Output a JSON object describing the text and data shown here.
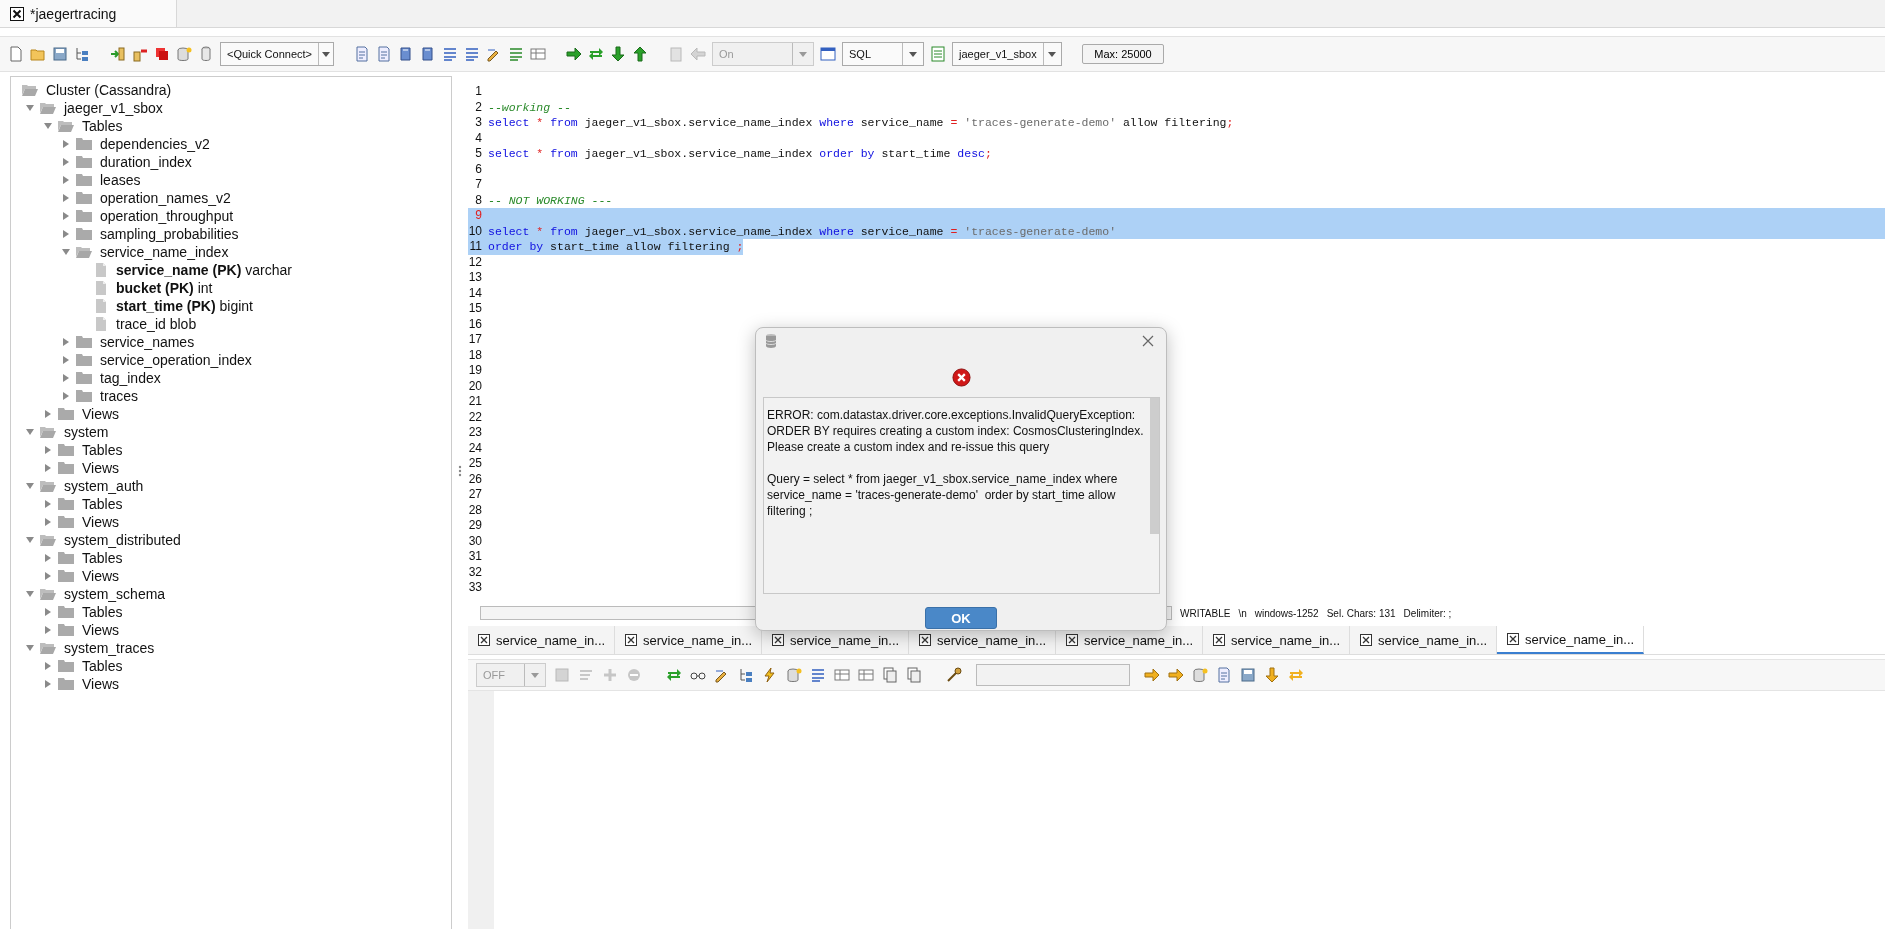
{
  "window_tab": {
    "title": "*jaegertracing",
    "selected": true
  },
  "toolbar": {
    "connection": "<Quick Connect>",
    "mode": {
      "value": "On",
      "disabled": true
    },
    "language": "SQL",
    "keyspace": "jaeger_v1_sbox",
    "max_rows": "Max: 25000"
  },
  "tree": [
    {
      "label": "Cluster (Cassandra)",
      "kind": "root",
      "expanded": true,
      "children": [
        {
          "label": "jaeger_v1_sbox",
          "kind": "folder",
          "expanded": true,
          "children": [
            {
              "label": "Tables",
              "kind": "folder",
              "expanded": true,
              "children": [
                {
                  "label": "dependencies_v2",
                  "kind": "folder",
                  "expanded": false
                },
                {
                  "label": "duration_index",
                  "kind": "folder",
                  "expanded": false
                },
                {
                  "label": "leases",
                  "kind": "folder",
                  "expanded": false
                },
                {
                  "label": "operation_names_v2",
                  "kind": "folder",
                  "expanded": false
                },
                {
                  "label": "operation_throughput",
                  "kind": "folder",
                  "expanded": false
                },
                {
                  "label": "sampling_probabilities",
                  "kind": "folder",
                  "expanded": false
                },
                {
                  "label": "service_name_index",
                  "kind": "folder",
                  "expanded": true,
                  "children": [
                    {
                      "label": "**service_name (PK)** varchar",
                      "kind": "column"
                    },
                    {
                      "label": "**bucket (PK)** int",
                      "kind": "column"
                    },
                    {
                      "label": "**start_time (PK)** bigint",
                      "kind": "column"
                    },
                    {
                      "label": "trace_id blob",
                      "kind": "column"
                    }
                  ]
                },
                {
                  "label": "service_names",
                  "kind": "folder",
                  "expanded": false
                },
                {
                  "label": "service_operation_index",
                  "kind": "folder",
                  "expanded": false
                },
                {
                  "label": "tag_index",
                  "kind": "folder",
                  "expanded": false
                },
                {
                  "label": "traces",
                  "kind": "folder",
                  "expanded": false
                }
              ]
            },
            {
              "label": "Views",
              "kind": "folder",
              "expanded": false
            }
          ]
        },
        {
          "label": "system",
          "kind": "folder",
          "expanded": true,
          "children": [
            {
              "label": "Tables",
              "kind": "folder",
              "expanded": false
            },
            {
              "label": "Views",
              "kind": "folder",
              "expanded": false
            }
          ]
        },
        {
          "label": "system_auth",
          "kind": "folder",
          "expanded": true,
          "children": [
            {
              "label": "Tables",
              "kind": "folder",
              "expanded": false
            },
            {
              "label": "Views",
              "kind": "folder",
              "expanded": false
            }
          ]
        },
        {
          "label": "system_distributed",
          "kind": "folder",
          "expanded": true,
          "children": [
            {
              "label": "Tables",
              "kind": "folder",
              "expanded": false
            },
            {
              "label": "Views",
              "kind": "folder",
              "expanded": false
            }
          ]
        },
        {
          "label": "system_schema",
          "kind": "folder",
          "expanded": true,
          "children": [
            {
              "label": "Tables",
              "kind": "folder",
              "expanded": false
            },
            {
              "label": "Views",
              "kind": "folder",
              "expanded": false
            }
          ]
        },
        {
          "label": "system_traces",
          "kind": "folder",
          "expanded": true,
          "children": [
            {
              "label": "Tables",
              "kind": "folder",
              "expanded": false
            },
            {
              "label": "Views",
              "kind": "folder",
              "expanded": false
            }
          ]
        }
      ]
    }
  ],
  "editor": {
    "lines": [
      {
        "number": "1",
        "selected": false,
        "current": false
      },
      {
        "number": "2",
        "selected": false,
        "current": false,
        "tokens": [
          {
            "kind": "comment",
            "text": "--working --"
          }
        ]
      },
      {
        "number": "3",
        "selected": false,
        "current": false,
        "tokens": [
          {
            "kind": "keyword",
            "text": "select "
          },
          {
            "kind": "operator",
            "text": "* "
          },
          {
            "kind": "keyword",
            "text": "from"
          },
          {
            "kind": "plain",
            "text": " jaeger_v1_sbox.service_name_index "
          },
          {
            "kind": "keyword",
            "text": "where"
          },
          {
            "kind": "plain",
            "text": " service_name "
          },
          {
            "kind": "operator",
            "text": "= "
          },
          {
            "kind": "string",
            "text": "'traces-generate-demo'"
          },
          {
            "kind": "plain",
            "text": " allow filtering"
          },
          {
            "kind": "operator",
            "text": ";"
          }
        ]
      },
      {
        "number": "4",
        "selected": false,
        "current": false
      },
      {
        "number": "5",
        "selected": false,
        "current": false,
        "tokens": [
          {
            "kind": "keyword",
            "text": "select "
          },
          {
            "kind": "operator",
            "text": "* "
          },
          {
            "kind": "keyword",
            "text": "from"
          },
          {
            "kind": "plain",
            "text": " jaeger_v1_sbox.service_name_index "
          },
          {
            "kind": "keyword",
            "text": "order by"
          },
          {
            "kind": "plain",
            "text": " start_time "
          },
          {
            "kind": "keyword",
            "text": "desc"
          },
          {
            "kind": "operator",
            "text": ";"
          }
        ]
      },
      {
        "number": "6",
        "selected": false,
        "current": false
      },
      {
        "number": "7",
        "selected": false,
        "current": false
      },
      {
        "number": "8",
        "selected": false,
        "current": false,
        "tokens": [
          {
            "kind": "comment",
            "text": "-- NOT WORKING ---"
          }
        ]
      },
      {
        "number": "9",
        "selected": true,
        "current": true
      },
      {
        "number": "10",
        "selected": true,
        "current": false,
        "tokens": [
          {
            "kind": "keyword",
            "text": "select "
          },
          {
            "kind": "operator",
            "text": "* "
          },
          {
            "kind": "keyword",
            "text": "from"
          },
          {
            "kind": "plain",
            "text": " jaeger_v1_sbox.service_name_index "
          },
          {
            "kind": "keyword",
            "text": "where"
          },
          {
            "kind": "plain",
            "text": " service_name "
          },
          {
            "kind": "operator",
            "text": "= "
          },
          {
            "kind": "string",
            "text": "'traces-generate-demo'"
          }
        ]
      },
      {
        "number": "11",
        "selected": true,
        "current": false,
        "tokens": [
          {
            "kind": "keyword",
            "text": "order by"
          },
          {
            "kind": "plain",
            "text": " start_time allow filtering "
          },
          {
            "kind": "operator",
            "text": ";"
          }
        ]
      },
      {
        "number": "12",
        "selected": false,
        "current": false
      },
      {
        "number": "13",
        "selected": false,
        "current": false
      },
      {
        "number": "14",
        "selected": false,
        "current": false
      },
      {
        "number": "15",
        "selected": false,
        "current": false
      },
      {
        "number": "16",
        "selected": false,
        "current": false
      },
      {
        "number": "17",
        "selected": false,
        "current": false
      },
      {
        "number": "18",
        "selected": false,
        "current": false
      },
      {
        "number": "19",
        "selected": false,
        "current": false
      },
      {
        "number": "20",
        "selected": false,
        "current": false
      },
      {
        "number": "21",
        "selected": false,
        "current": false
      },
      {
        "number": "22",
        "selected": false,
        "current": false
      },
      {
        "number": "23",
        "selected": false,
        "current": false
      },
      {
        "number": "24",
        "selected": false,
        "current": false
      },
      {
        "number": "25",
        "selected": false,
        "current": false
      },
      {
        "number": "26",
        "selected": false,
        "current": false
      },
      {
        "number": "27",
        "selected": false,
        "current": false
      },
      {
        "number": "28",
        "selected": false,
        "current": false
      },
      {
        "number": "29",
        "selected": false,
        "current": false
      },
      {
        "number": "30",
        "selected": false,
        "current": false
      },
      {
        "number": "31",
        "selected": false,
        "current": false
      },
      {
        "number": "32",
        "selected": false,
        "current": false
      },
      {
        "number": "33",
        "selected": false,
        "current": false
      }
    ]
  },
  "status_bar": [
    "WRITABLE",
    "\\n",
    "windows-1252",
    "Sel. Chars: 131",
    "Delimiter: ;"
  ],
  "result_tabs": [
    {
      "label": "service_name_in...",
      "selected": false
    },
    {
      "label": "service_name_in...",
      "selected": false
    },
    {
      "label": "service_name_in...",
      "selected": false
    },
    {
      "label": "service_name_in...",
      "selected": false
    },
    {
      "label": "service_name_in...",
      "selected": false
    },
    {
      "label": "service_name_in...",
      "selected": false
    },
    {
      "label": "service_name_in...",
      "selected": false
    },
    {
      "label": "service_name_in...",
      "selected": true
    }
  ],
  "result_toolbar": {
    "filter": {
      "value": "OFF",
      "disabled": true
    }
  },
  "dialog": {
    "message": "ERROR: com.datastax.driver.core.exceptions.InvalidQueryException:\nORDER BY requires creating a custom index: CosmosClusteringIndex.\nPlease create a custom index and re-issue this query\n\nQuery = select * from jaeger_v1_sbox.service_name_index where service_name = 'traces-generate-demo'  order by start_time allow filtering ;",
    "ok": "OK"
  }
}
